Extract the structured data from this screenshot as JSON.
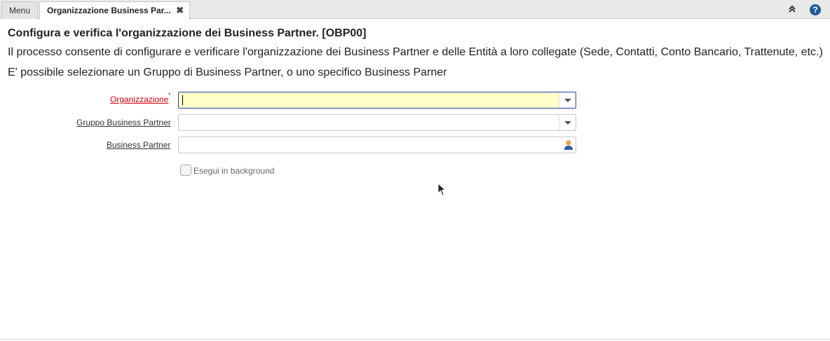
{
  "tabs": {
    "menu": "Menu",
    "active": "Organizzazione Business Par...",
    "close": "✖"
  },
  "toolbar": {
    "collapse_icon": "chevron-double-up-icon",
    "help_icon": "help-icon",
    "collapse_glyph": "⌃",
    "help_glyph": "?"
  },
  "header": {
    "title": "Configura e verifica l'organizzazione dei Business Partner. [OBP00]",
    "description": "Il processo consente di configurare e verificare l'organizzazione dei Business Partner e delle Entità a loro collegate (Sede, Contatti, Conto Bancario, Trattenute, etc.)",
    "description2": "E' possibile selezionare un Gruppo di Business Partner, o uno specifico Business Parner"
  },
  "form": {
    "organizzazione": {
      "label": "Organizzazione",
      "required_mark": "*",
      "value": ""
    },
    "gruppo": {
      "label": "Gruppo Business Partner",
      "value": ""
    },
    "business_partner": {
      "label": "Business Partner",
      "value": ""
    },
    "background": {
      "label": "Esegui in background",
      "checked": false
    }
  },
  "colors": {
    "required": "#d8000c",
    "focus_border": "#2a3fa8",
    "focus_bg": "#ffffc8",
    "help_bg": "#1f5c99"
  }
}
